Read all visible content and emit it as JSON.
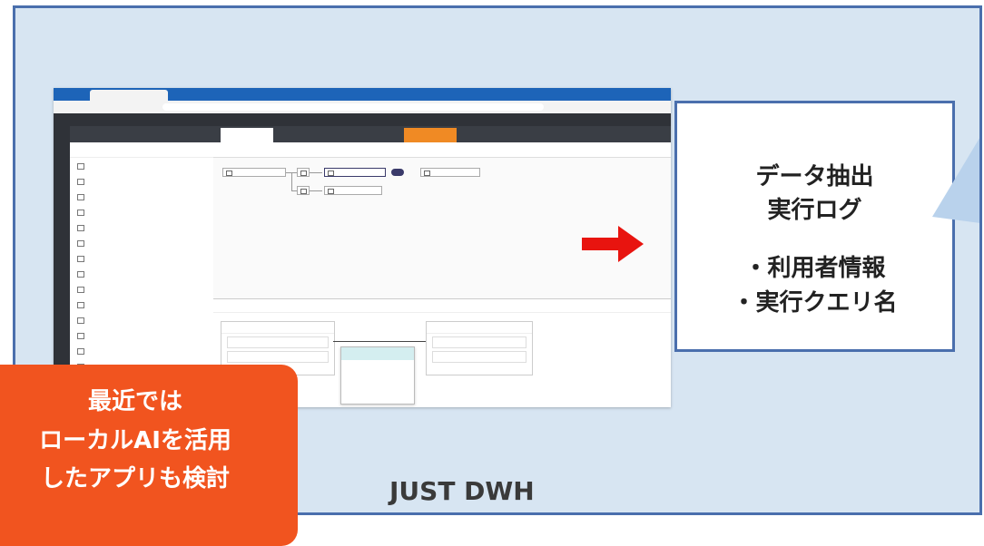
{
  "box": {
    "line1": "データ抽出",
    "line2": "実行ログ",
    "line3": "・利用者情報",
    "line4": "・実行クエリ名"
  },
  "badge": {
    "line1": "最近では",
    "line2": "ローカルAIを活用",
    "line3": "したアプリも検討"
  },
  "caption": "JUST DWH",
  "colors": {
    "slide_bg": "#d7e5f2",
    "slide_border": "#4a6fad",
    "arrow": "#e8140f",
    "badge": "#f1541f",
    "browser_titlebar": "#1d64b8",
    "app_dark": "#2f3238",
    "tab_orange": "#f08a24"
  },
  "icons": [
    "right-arrow-icon",
    "speech-bubble-tail",
    "table-icon"
  ]
}
